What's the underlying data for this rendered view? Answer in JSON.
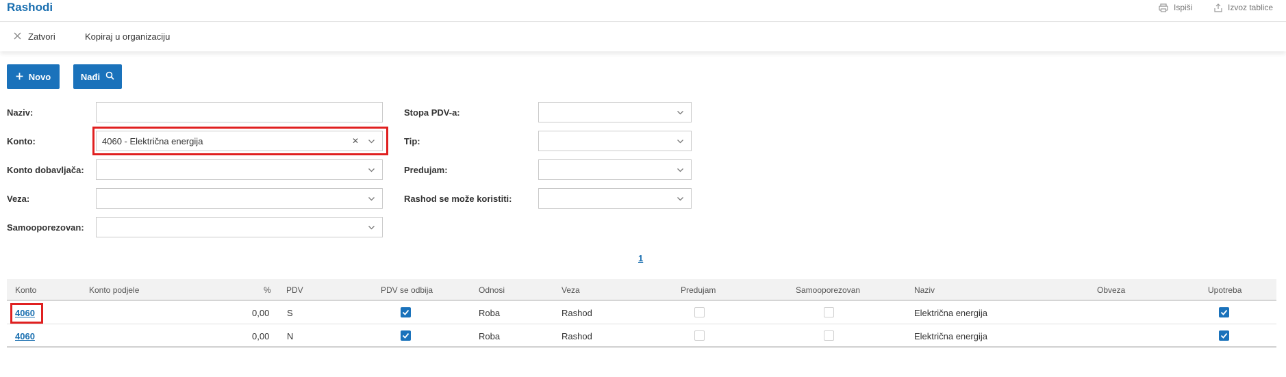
{
  "header": {
    "title": "Rashodi",
    "print_label": "Ispiši",
    "export_label": "Izvoz tablice"
  },
  "actions": {
    "close_label": "Zatvori",
    "copy_label": "Kopiraj u organizaciju"
  },
  "buttons": {
    "new_label": "Novo",
    "find_label": "Nađi"
  },
  "filters": {
    "naziv": {
      "label": "Naziv:",
      "value": ""
    },
    "konto": {
      "label": "Konto:",
      "value": "4060 - Električna energija"
    },
    "konto_dobavljaca": {
      "label": "Konto dobavljača:",
      "value": ""
    },
    "veza": {
      "label": "Veza:",
      "value": ""
    },
    "samooporezovan": {
      "label": "Samooporezovan:",
      "value": ""
    },
    "stopa_pdv": {
      "label": "Stopa PDV-a:",
      "value": ""
    },
    "tip": {
      "label": "Tip:",
      "value": ""
    },
    "predujam": {
      "label": "Predujam:",
      "value": ""
    },
    "rashod_koristiti": {
      "label": "Rashod se može koristiti:",
      "value": ""
    }
  },
  "pagination": {
    "current": "1"
  },
  "table": {
    "columns": [
      "Konto",
      "Konto podjele",
      "%",
      "PDV",
      "PDV se odbija",
      "Odnosi",
      "Veza",
      "Predujam",
      "Samooporezovan",
      "Naziv",
      "Obveza",
      "Upotreba"
    ],
    "rows": [
      {
        "konto": "4060",
        "konto_podjele": "",
        "percent": "0,00",
        "pdv": "S",
        "pdv_se_odbija": true,
        "odnosi": "Roba",
        "veza": "Rashod",
        "predujam": false,
        "samooporezovan": false,
        "naziv": "Električna energija",
        "obveza": "",
        "upotreba": true
      },
      {
        "konto": "4060",
        "konto_podjele": "",
        "percent": "0,00",
        "pdv": "N",
        "pdv_se_odbija": true,
        "odnosi": "Roba",
        "veza": "Rashod",
        "predujam": false,
        "samooporezovan": false,
        "naziv": "Električna energija",
        "obveza": "",
        "upotreba": true
      }
    ]
  },
  "colors": {
    "primary": "#1a72bb",
    "link": "#1a6fb0",
    "highlight": "#e02020"
  },
  "icons": [
    "printer-icon",
    "export-icon",
    "close-icon",
    "plus-icon",
    "search-icon",
    "chevron-down-icon",
    "clear-icon",
    "checkbox-checked-icon"
  ]
}
